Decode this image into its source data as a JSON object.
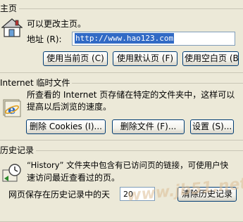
{
  "homepage": {
    "legend": "主页",
    "description": "可以更改主页。",
    "address_label": "地址 (R):",
    "address_value": "http://www.hao123.com",
    "buttons": [
      "使用当前页 (C)",
      "使用默认页 (F)",
      "使用空白页 (B)"
    ]
  },
  "temp_files": {
    "legend": "Internet 临时文件",
    "description_line1": "所查看的 Internet 页存储在特定的文件夹中，这样可以",
    "description_line2": "提高以后浏览的速度。",
    "buttons": [
      "删除 Cookies (I)...",
      "删除文件 (F)...",
      "设置 (S)..."
    ]
  },
  "history": {
    "legend": "历史记录",
    "description_line1": "“History” 文件夹中包含有已访问页的链接，可使用户快",
    "description_line2": "速访问最近查看过的页。",
    "days_label": "网页保存在历史记录中的天",
    "days_value": "20",
    "clear_button": "清除历史记录"
  },
  "watermark": "www.jb51.net",
  "icons": [
    "house-icon",
    "internet-explorer-icon",
    "history-icon"
  ]
}
